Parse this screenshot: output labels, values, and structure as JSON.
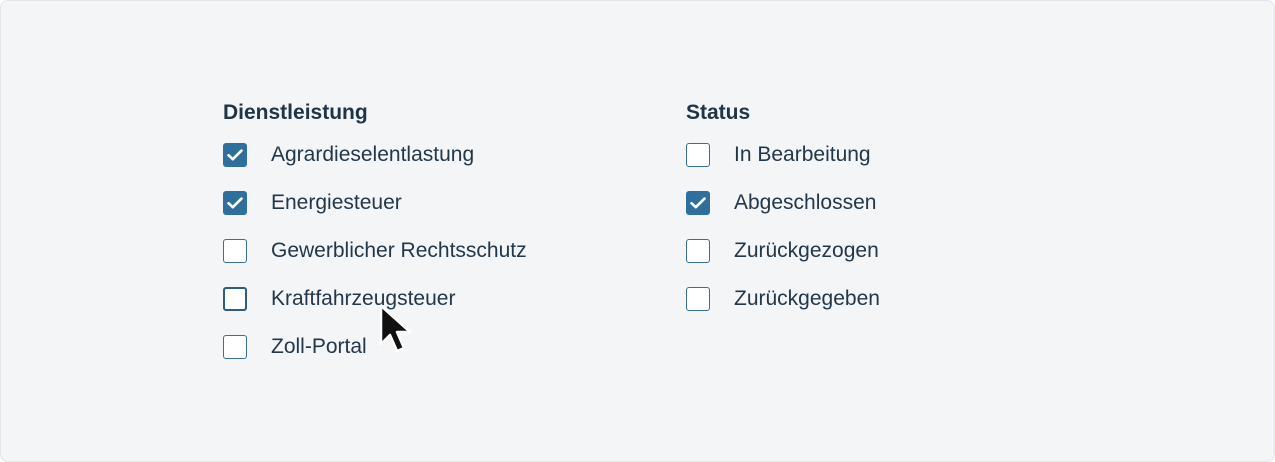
{
  "filters": {
    "service": {
      "heading": "Dienstleistung",
      "options": [
        {
          "label": "Agrardieselentlastung",
          "checked": true
        },
        {
          "label": "Energiesteuer",
          "checked": true
        },
        {
          "label": "Gewerblicher Rechtsschutz",
          "checked": false
        },
        {
          "label": "Kraftfahrzeugsteuer",
          "checked": false
        },
        {
          "label": "Zoll-Portal",
          "checked": false
        }
      ]
    },
    "status": {
      "heading": "Status",
      "options": [
        {
          "label": "In Bearbeitung",
          "checked": false
        },
        {
          "label": "Abgeschlossen",
          "checked": true
        },
        {
          "label": "Zurückgezogen",
          "checked": false
        },
        {
          "label": "Zurückgegeben",
          "checked": false
        }
      ]
    }
  },
  "colors": {
    "accent": "#2f6f9e",
    "text": "#22384a",
    "background": "#f4f5f7"
  },
  "icons": {
    "check": "checkmark-icon",
    "cursor": "mouse-pointer-icon"
  }
}
